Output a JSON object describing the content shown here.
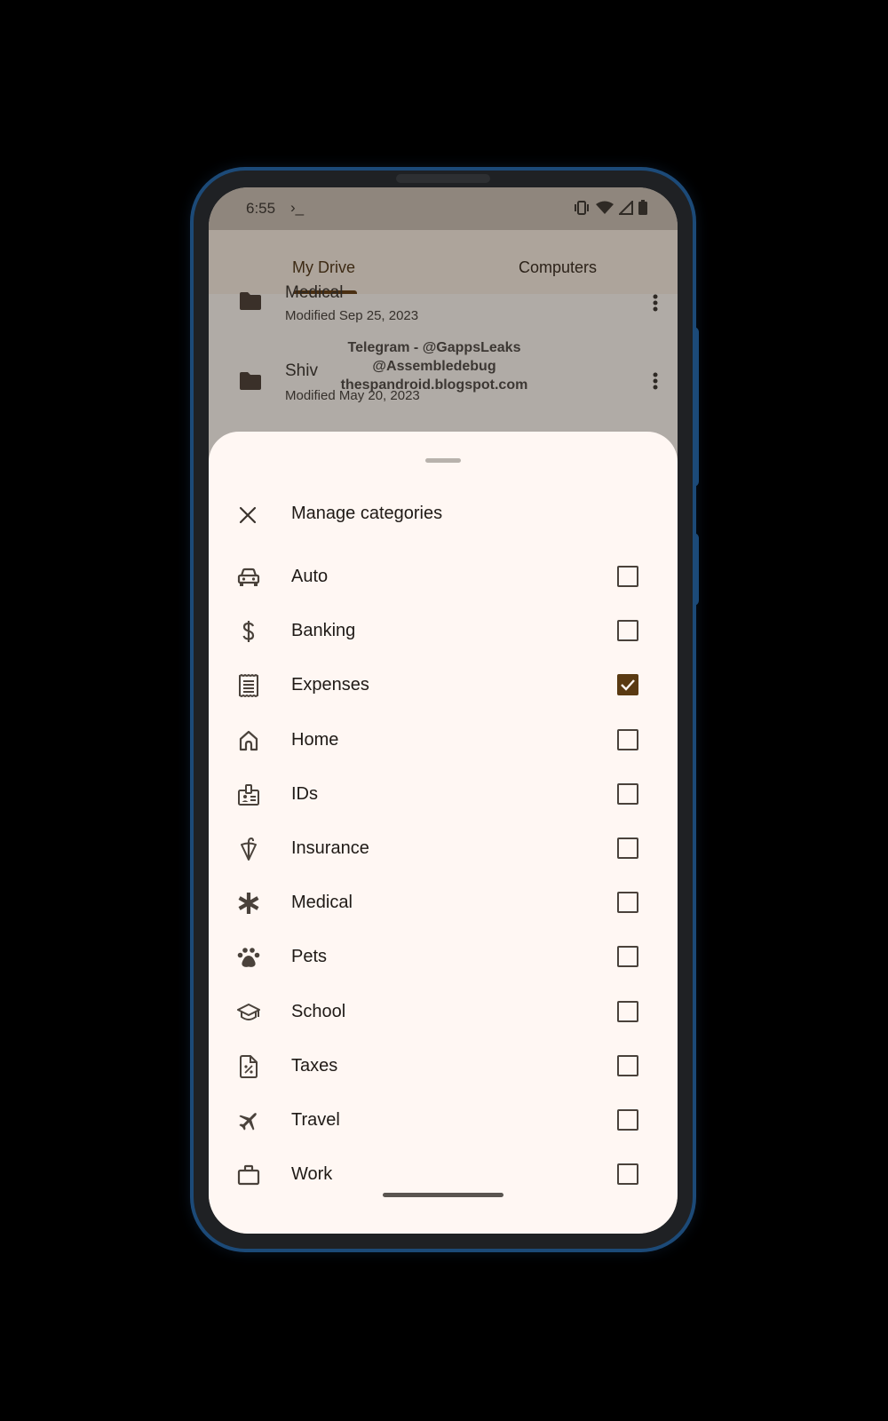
{
  "status_bar": {
    "time": "6:55",
    "terminal_glyph": "›_",
    "icons": [
      "vibrate-icon",
      "wifi-icon",
      "cellular-signal-icon",
      "battery-icon"
    ]
  },
  "drive": {
    "tabs": [
      {
        "label": "My Drive",
        "selected": true
      },
      {
        "label": "Computers",
        "selected": false
      }
    ],
    "files": [
      {
        "name": "Medical",
        "meta": "Modified Sep 25, 2023"
      },
      {
        "name": "Shiv",
        "meta": "Modified May 20, 2023"
      }
    ],
    "watermark": [
      "Telegram - @GappsLeaks",
      "@Assembledebug",
      "thespandroid.blogspot.com"
    ]
  },
  "sheet": {
    "title": "Manage categories",
    "close_icon": "close-icon",
    "categories": [
      {
        "label": "Auto",
        "icon": "car-icon",
        "checked": false
      },
      {
        "label": "Banking",
        "icon": "dollar-icon",
        "checked": false
      },
      {
        "label": "Expenses",
        "icon": "receipt-icon",
        "checked": true
      },
      {
        "label": "Home",
        "icon": "home-icon",
        "checked": false
      },
      {
        "label": "IDs",
        "icon": "id-badge-icon",
        "checked": false
      },
      {
        "label": "Insurance",
        "icon": "umbrella-icon",
        "checked": false
      },
      {
        "label": "Medical",
        "icon": "asterisk-icon",
        "checked": false
      },
      {
        "label": "Pets",
        "icon": "paw-icon",
        "checked": false
      },
      {
        "label": "School",
        "icon": "graduation-cap-icon",
        "checked": false
      },
      {
        "label": "Taxes",
        "icon": "tax-document-icon",
        "checked": false
      },
      {
        "label": "Travel",
        "icon": "airplane-icon",
        "checked": false
      },
      {
        "label": "Work",
        "icon": "briefcase-icon",
        "checked": false
      }
    ]
  },
  "colors": {
    "accent": "#5a3a12",
    "sheet_bg": "#fff7f3",
    "icon": "#4a423b",
    "frame": "#1c4a78"
  }
}
